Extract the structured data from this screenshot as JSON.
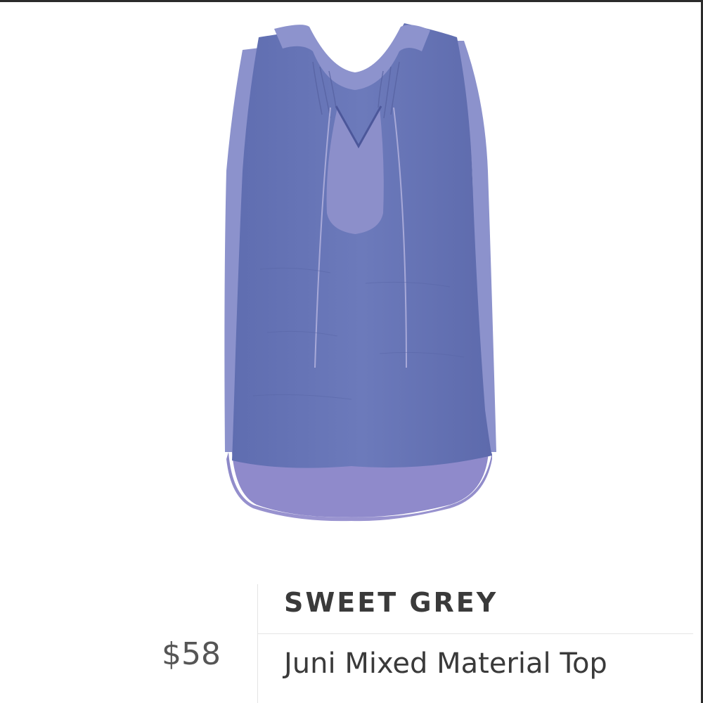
{
  "product": {
    "image_alt": "sleeveless blue-purple blouse",
    "brand": "SWEET GREY",
    "price": "$58",
    "name": "Juni Mixed Material Top"
  },
  "colors": {
    "garment_main": "#6b79b8",
    "garment_light": "#8e95cf",
    "garment_shadow": "#5a66a6",
    "text_dark": "#3a3a3a",
    "text_price": "#555555"
  }
}
